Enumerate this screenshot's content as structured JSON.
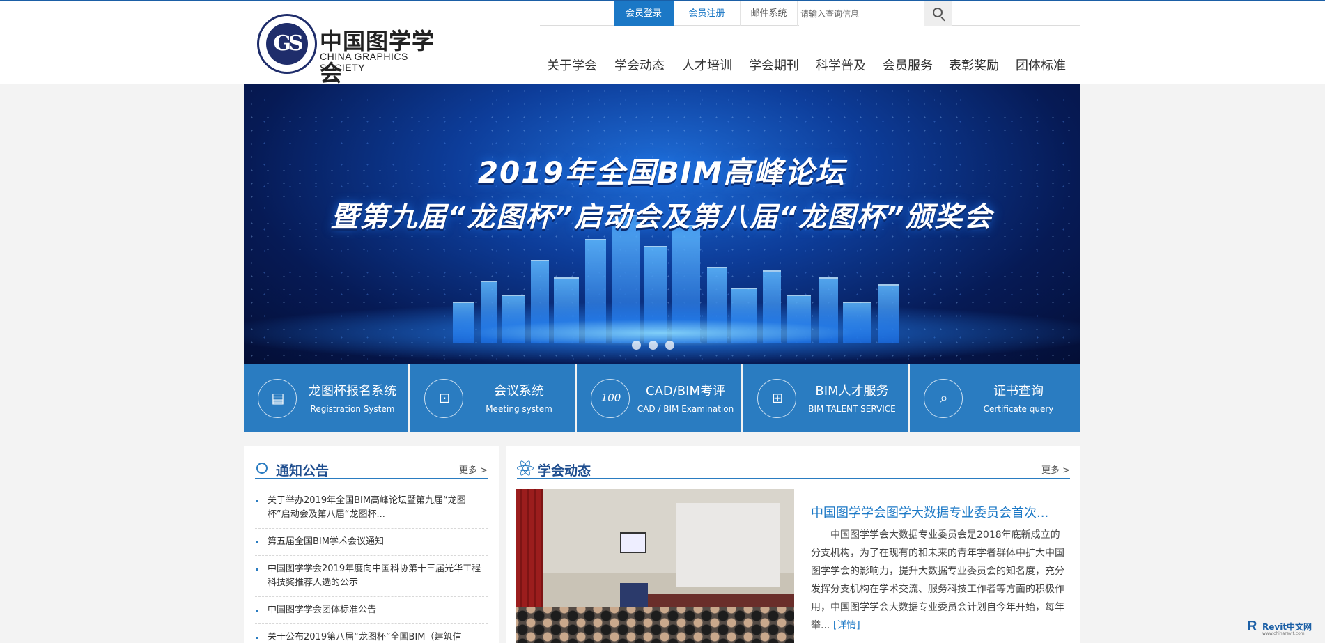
{
  "logo": {
    "cn": "中国图学学会",
    "en": "CHINA GRAPHICS SOCIETY",
    "seal_text": "GS"
  },
  "topbar": {
    "login": "会员登录",
    "register": "会员注册",
    "mail": "邮件系统",
    "search_placeholder": "请输入查询信息"
  },
  "nav": [
    "关于学会",
    "学会动态",
    "人才培训",
    "学会期刊",
    "科学普及",
    "会员服务",
    "表彰奖励",
    "团体标准"
  ],
  "banner": {
    "line1": "2019年全国BIM高峰论坛",
    "line2": "暨第九届“龙图杯”启动会及第八届“龙图杯”颁奖会",
    "slides": 3
  },
  "services": [
    {
      "title": "龙图杯报名系统",
      "sub": "Registration System",
      "icon": "form-icon"
    },
    {
      "title": "会议系统",
      "sub": "Meeting system",
      "icon": "presentation-icon"
    },
    {
      "title": "CAD/BIM考评",
      "sub": "CAD / BIM Examination",
      "icon": "score-100-icon"
    },
    {
      "title": "BIM人才服务",
      "sub": "BIM TALENT SERVICE",
      "icon": "grid-icon"
    },
    {
      "title": "证书查询",
      "sub": "Certificate query",
      "icon": "search-icon"
    }
  ],
  "notices": {
    "title": "通知公告",
    "more": "更多 >",
    "items": [
      "关于举办2019年全国BIM高峰论坛暨第九届“龙图杯”启动会及第八届“龙图杯...",
      "第五届全国BIM学术会议通知",
      "中国图学学会2019年度向中国科协第十三届光华工程科技奖推荐人选的公示",
      "中国图学学会团体标准公告",
      "关于公布2019第八届“龙图杯”全国BIM（建筑信"
    ]
  },
  "news": {
    "title": "学会动态",
    "more": "更多 >",
    "headline": "中国图学学会图学大数据专业委员会首次...",
    "body": "中国图学学会大数据专业委员会是2018年底新成立的分支机构，为了在现有的和未来的青年学者群体中扩大中国图学学会的影响力，提升大数据专业委员会的知名度，充分发挥分支机构在学术交流、服务科技工作者等方面的积极作用，中国图学学会大数据专业委员会计划自今年开始，每年举...",
    "detail": "[详情]"
  },
  "watermark": {
    "brand": "Revit中文网",
    "url": "www.chinarevit.com"
  },
  "colors": {
    "primary": "#1b78c6",
    "service_bg": "#2a7cc1",
    "heading": "#1f4e8f"
  }
}
